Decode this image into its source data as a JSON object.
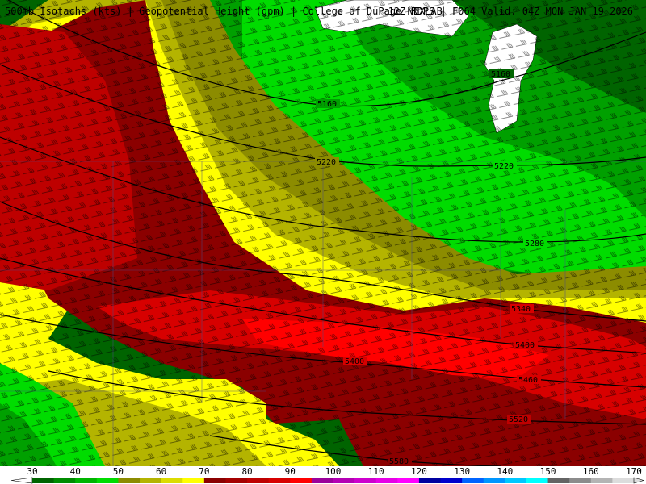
{
  "header": {
    "left_text": "500mb Isotachs (kts) | Geopotential Height (gpm) | College of DuPage NEXLAB",
    "right_text": "12Z RDPS | F064 Valid: 04Z MON JAN 19 2026"
  },
  "contour_labels": [
    "5160",
    "5160",
    "5220",
    "5220",
    "5280",
    "5340",
    "5400",
    "5400",
    "5460",
    "5520",
    "5580"
  ],
  "colorbar": {
    "ticks": [
      "30",
      "40",
      "50",
      "60",
      "70",
      "80",
      "90",
      "100",
      "110",
      "120",
      "130",
      "140",
      "150",
      "160",
      "170"
    ],
    "colors": [
      "#006400",
      "#008c00",
      "#00b400",
      "#00dc00",
      "#8c8c00",
      "#b4b400",
      "#dcdc00",
      "#ffff00",
      "#8b0000",
      "#a50000",
      "#be0000",
      "#d70000",
      "#ff0000",
      "#9b009b",
      "#b400b4",
      "#cd00cd",
      "#e600e6",
      "#ff00ff",
      "#0000a0",
      "#0000cd",
      "#0064ff",
      "#0096ff",
      "#00c8ff",
      "#00ffff",
      "#646464",
      "#8c8c8c",
      "#b4b4b4",
      "#dcdcdc"
    ]
  }
}
